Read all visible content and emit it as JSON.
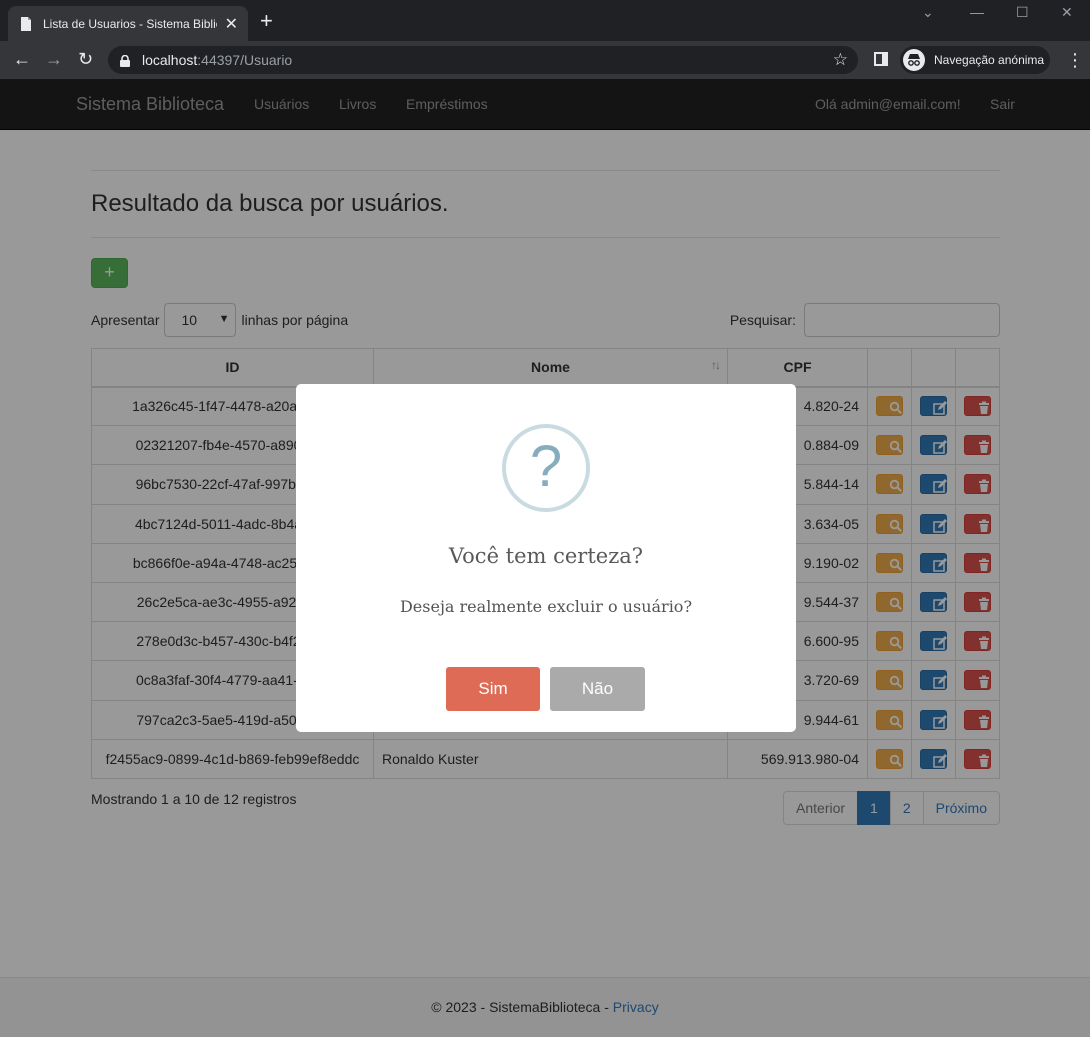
{
  "browser": {
    "tab_title": "Lista de Usuarios - Sistema Biblio",
    "new_tab": "+",
    "url_host": "localhost",
    "url_path": ":44397/Usuario",
    "incognito_label": "Navegação anónima",
    "window_controls": [
      "minimize",
      "maximize",
      "close"
    ]
  },
  "navbar": {
    "brand": "Sistema Biblioteca",
    "links": [
      "Usuários",
      "Livros",
      "Empréstimos"
    ],
    "greeting": "Olá admin@email.com!",
    "logout": "Sair"
  },
  "page": {
    "title": "Resultado da busca por usuários.",
    "add_button": "+",
    "length_prefix": "Apresentar",
    "length_value": "10",
    "length_suffix": "linhas por página",
    "search_label": "Pesquisar:",
    "columns": [
      "ID",
      "Nome",
      "CPF"
    ],
    "rows": [
      {
        "id": "1a326c45-1f47-4478-a20a-293b",
        "nome": "",
        "cpf": "4.820-24"
      },
      {
        "id": "02321207-fb4e-4570-a890-5dd",
        "nome": "",
        "cpf": "0.884-09"
      },
      {
        "id": "96bc7530-22cf-47af-997b-ccbc",
        "nome": "",
        "cpf": "5.844-14"
      },
      {
        "id": "4bc7124d-5011-4adc-8b4a-929",
        "nome": "",
        "cpf": "3.634-05"
      },
      {
        "id": "bc866f0e-a94a-4748-ac25-076c",
        "nome": "",
        "cpf": "9.190-02"
      },
      {
        "id": "26c2e5ca-ae3c-4955-a925-12f",
        "nome": "",
        "cpf": "9.544-37"
      },
      {
        "id": "278e0d3c-b457-430c-b4f2-94b",
        "nome": "",
        "cpf": "6.600-95"
      },
      {
        "id": "0c8a3faf-30f4-4779-aa41-1375",
        "nome": "",
        "cpf": "3.720-69"
      },
      {
        "id": "797ca2c3-5ae5-419d-a509-08f",
        "nome": "",
        "cpf": "9.944-61"
      },
      {
        "id": "f2455ac9-0899-4c1d-b869-feb99ef8eddc",
        "nome": "Ronaldo Kuster",
        "cpf": "569.913.980-04"
      }
    ],
    "info": "Mostrando 1 a 10 de 12 registros",
    "pager": {
      "prev": "Anterior",
      "pages": [
        "1",
        "2"
      ],
      "next": "Próximo"
    }
  },
  "footer": {
    "text": "© 2023 - SistemaBiblioteca - ",
    "privacy": "Privacy"
  },
  "modal": {
    "icon": "?",
    "title": "Você tem certeza?",
    "text": "Deseja realmente excluir o usuário?",
    "confirm": "Sim",
    "cancel": "Não"
  },
  "colors": {
    "success": "#5cb85c",
    "primary": "#337ab7",
    "warning": "#f0ad4e",
    "danger": "#d9534f",
    "confirm": "#dd6b55",
    "cancel": "#aaaaaa"
  }
}
